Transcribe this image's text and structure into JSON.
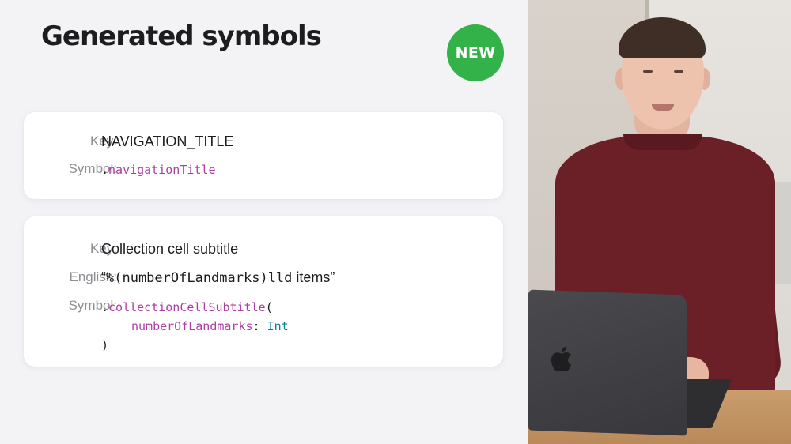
{
  "slide": {
    "title": "Generated symbols",
    "badge": "NEW"
  },
  "card1": {
    "key_label": "Key:",
    "key_value": "NAVIGATION_TITLE",
    "symbol_label": "Symbol:",
    "symbol_dot": ".",
    "symbol_name": "navigationTitle"
  },
  "card2": {
    "key_label": "Key:",
    "key_value": "Collection cell subtitle",
    "english_label": "English:",
    "english_open_quote": "“",
    "english_code": "%(numberOfLandmarks)lld",
    "english_text": " items”",
    "symbol_label": "Symbol:",
    "symbol_dot": ".",
    "symbol_func": "collectionCellSubtitle",
    "symbol_open_paren": "(",
    "param_name": "numberOfLandmarks",
    "param_colon": ": ",
    "param_type": "Int",
    "symbol_close_paren": ")"
  },
  "colors": {
    "badge": "#34b24a",
    "code_function": "#ad3da4",
    "code_type": "#0b7f91",
    "label_gray": "#8e8e93",
    "slide_background": "#f3f3f6"
  },
  "icons": {
    "laptop_logo": "apple-logo-icon"
  }
}
